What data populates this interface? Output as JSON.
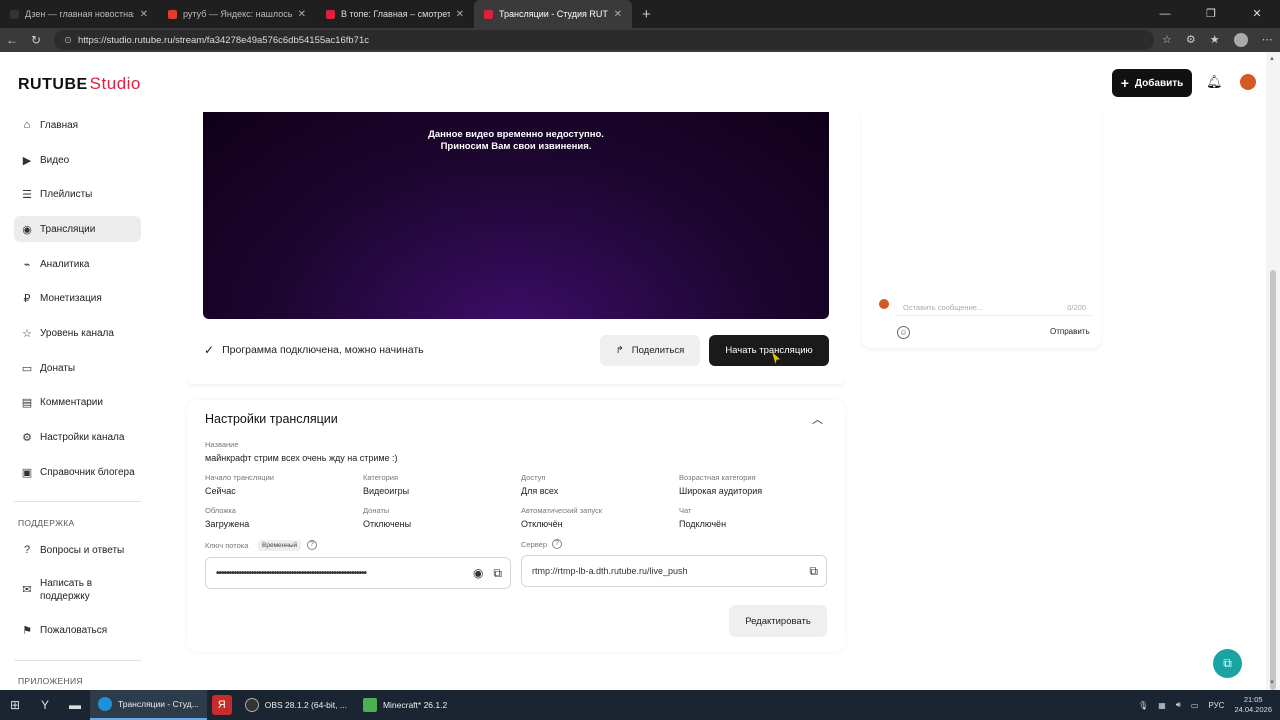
{
  "browser": {
    "tabs": [
      {
        "title": "Дзен — главная новостная инф",
        "color": "#333333"
      },
      {
        "title": "рутуб — Яндекс: нашлось 5 тыс",
        "color": "#e03b2b"
      },
      {
        "title": "В топе: Главная – смотреть онлай",
        "color": "#e0203f"
      },
      {
        "title": "Трансляции - Студия RUTUBE",
        "color": "#e0203f"
      }
    ],
    "url": "https://studio.rutube.ru/stream/fa34278e49a576c6db54155ac16fb71c"
  },
  "header": {
    "logo_main": "RUTUBE",
    "logo_studio": "Studio",
    "add_label": "Добавить"
  },
  "sidebar": {
    "items": [
      {
        "label": "Главная",
        "icon": "home-icon"
      },
      {
        "label": "Видео",
        "icon": "video-icon"
      },
      {
        "label": "Плейлисты",
        "icon": "playlist-icon"
      },
      {
        "label": "Трансляции",
        "icon": "broadcast-icon"
      },
      {
        "label": "Аналитика",
        "icon": "analytics-icon"
      },
      {
        "label": "Монетизация",
        "icon": "ruble-icon"
      },
      {
        "label": "Уровень канала",
        "icon": "star-icon"
      },
      {
        "label": "Донаты",
        "icon": "donate-icon"
      },
      {
        "label": "Комментарии",
        "icon": "comment-icon"
      },
      {
        "label": "Настройки канала",
        "icon": "settings-icon"
      },
      {
        "label": "Справочник блогера",
        "icon": "guide-icon"
      }
    ],
    "support_heading": "ПОДДЕРЖКА",
    "support_items": [
      {
        "label": "Вопросы и ответы",
        "icon": "help-icon"
      },
      {
        "label": "Написать в поддержку",
        "icon": "mail-icon"
      },
      {
        "label": "Пожаловаться",
        "icon": "flag-icon"
      }
    ],
    "apps_heading": "ПРИЛОЖЕНИЯ"
  },
  "player": {
    "message_line1": "Данное видео временно недоступно.",
    "message_line2": "Приносим Вам свои извинения."
  },
  "stream": {
    "status": "Программа подключена, можно начинать",
    "share_label": "Поделиться",
    "start_label": "Начать трансляцию"
  },
  "settings": {
    "title": "Настройки трансляции",
    "name_label": "Название",
    "name_value": "майнкрафт стрим всех очень жду на стриме :)",
    "start_label": "Начало трансляции",
    "start_value": "Сейчас",
    "category_label": "Категория",
    "category_value": "Видеоигры",
    "access_label": "Доступ",
    "access_value": "Для всех",
    "age_label": "Возрастная категория",
    "age_value": "Широкая аудитория",
    "cover_label": "Обложка",
    "cover_value": "Загружена",
    "donates_label": "Донаты",
    "donates_value": "Отключены",
    "autostart_label": "Автоматический запуск",
    "autostart_value": "Отключён",
    "chat_label": "Чат",
    "chat_value": "Подключён",
    "key_label": "Ключ потока",
    "key_badge": "Временный",
    "key_value": "••••••••••••••••••••••••••••••••••••••••••••••••••••••••••••",
    "server_label": "Сервер",
    "server_value": "rtmp://rtmp-lb-a.dth.rutube.ru/live_push",
    "edit_label": "Редактировать"
  },
  "chat": {
    "placeholder": "Оставить сообщение...",
    "counter": "0/200",
    "send_label": "Отправить"
  },
  "taskbar": {
    "apps": [
      {
        "label": "Трансляции - Студ...",
        "color": "#1e90d6"
      },
      {
        "label": "OBS 28.1.2 (64-bit, ...",
        "color": "#333333"
      },
      {
        "label": "Minecraft* 26.1.2",
        "color": "#4caf50"
      }
    ],
    "lang": "РУС",
    "time": "21:05",
    "date": "24.04.2026"
  }
}
